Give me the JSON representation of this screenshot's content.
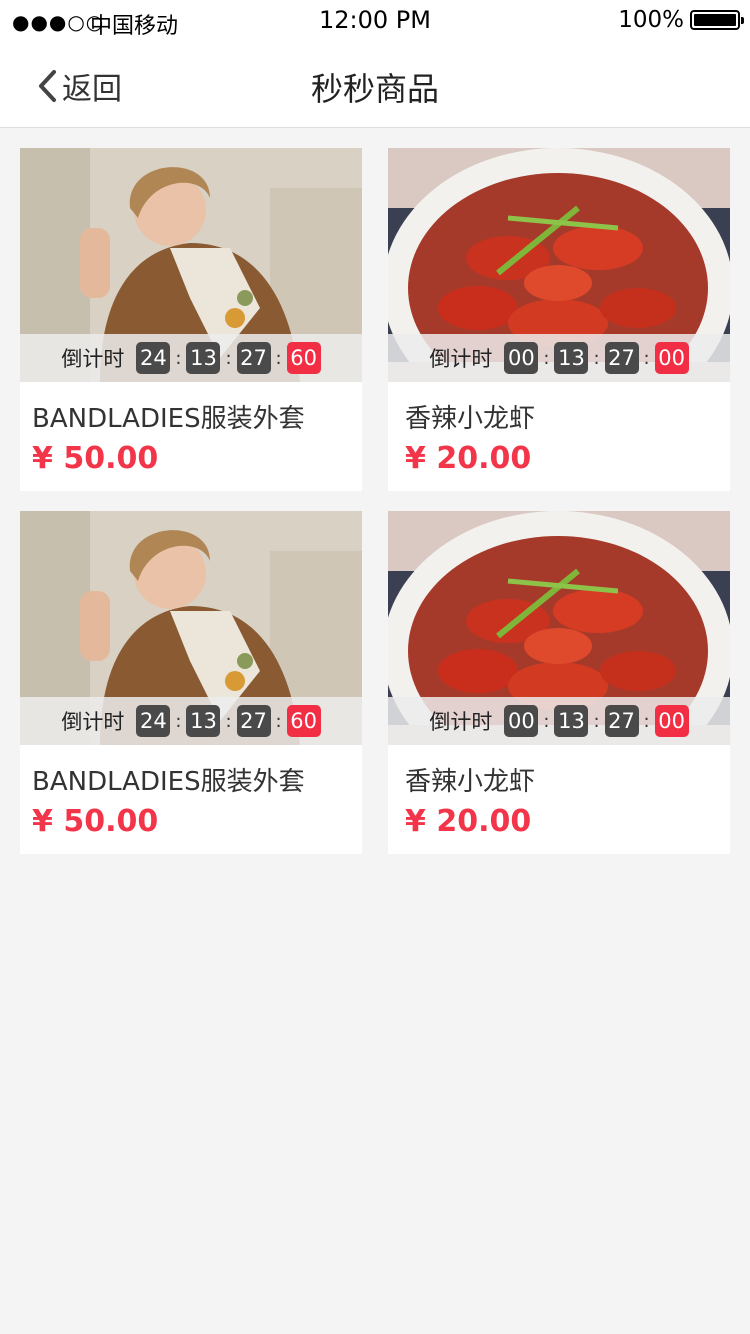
{
  "status_bar": {
    "signal": "●●●○○",
    "carrier": "中国移动",
    "time": "12:00 PM",
    "battery": "100%"
  },
  "nav": {
    "back_label": "返回",
    "title": "秒秒商品"
  },
  "colors": {
    "accent_red": "#f3354a",
    "timer_dark": "#4a4a4a",
    "page_bg": "#f4f4f4"
  },
  "products": [
    {
      "image": "woman-sweater-photo",
      "timer_label": "倒计时",
      "hh": "24",
      "mm": "13",
      "ss": "27",
      "ms": "60",
      "name": "BANDLADIES服装外套",
      "price": "¥ 50.00"
    },
    {
      "image": "crayfish-plate-photo",
      "timer_label": "倒计时",
      "hh": "00",
      "mm": "13",
      "ss": "27",
      "ms": "00",
      "name": "香辣小龙虾",
      "price": "¥ 20.00"
    },
    {
      "image": "woman-sweater-photo",
      "timer_label": "倒计时",
      "hh": "24",
      "mm": "13",
      "ss": "27",
      "ms": "60",
      "name": "BANDLADIES服装外套",
      "price": "¥ 50.00"
    },
    {
      "image": "crayfish-plate-photo",
      "timer_label": "倒计时",
      "hh": "00",
      "mm": "13",
      "ss": "27",
      "ms": "00",
      "name": "香辣小龙虾",
      "price": "¥ 20.00"
    }
  ]
}
